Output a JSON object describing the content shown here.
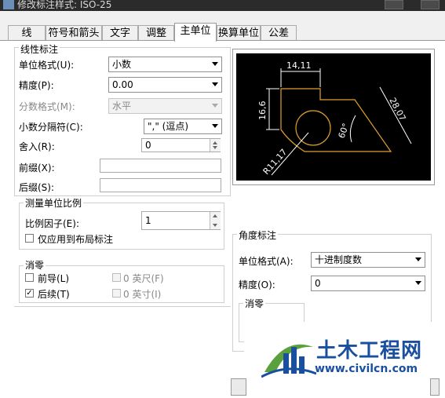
{
  "window": {
    "title": "修改标注样式: ISO-25"
  },
  "tabs": [
    {
      "label": "线"
    },
    {
      "label": "符号和箭头"
    },
    {
      "label": "文字"
    },
    {
      "label": "调整"
    },
    {
      "label": "主单位"
    },
    {
      "label": "换算单位"
    },
    {
      "label": "公差"
    }
  ],
  "linear": {
    "title": "线性标注",
    "unit_format_label": "单位格式(U):",
    "unit_format_value": "小数",
    "precision_label": "精度(P):",
    "precision_value": "0.00",
    "fraction_label": "分数格式(M):",
    "fraction_value": "水平",
    "decimal_sep_label": "小数分隔符(C):",
    "decimal_sep_value": "\",\"  (逗点)",
    "round_label": "舍入(R):",
    "round_value": "0",
    "prefix_label": "前缀(X):",
    "prefix_value": "",
    "suffix_label": "后缀(S):",
    "suffix_value": ""
  },
  "scale": {
    "title": "测量单位比例",
    "factor_label": "比例因子(E):",
    "factor_value": "1",
    "layout_only_label": "仅应用到布局标注"
  },
  "zero": {
    "title": "消零",
    "leading_label": "前导(L)",
    "trailing_label": "后续(T)",
    "sub_units_a": "0 英尺(F)",
    "sub_units_b": "0 英寸(I)"
  },
  "preview": {
    "dim_top": "14,11",
    "dim_left": "16,6",
    "dim_right": "28,07",
    "dim_angle": "60°",
    "dim_radius": "R11,17"
  },
  "angular": {
    "title": "角度标注",
    "unit_format_label": "单位格式(A):",
    "unit_format_value": "十进制度数",
    "precision_label": "精度(O):",
    "precision_value": "0",
    "zero_title": "消零"
  },
  "watermark": {
    "cn": "土木工程网",
    "url": "www.civilcn.com"
  },
  "colors": {
    "preview_bg": "#000000",
    "preview_line": "#e0a030",
    "dim_line": "#ffffff",
    "brand_blue": "#1a4fa0"
  }
}
